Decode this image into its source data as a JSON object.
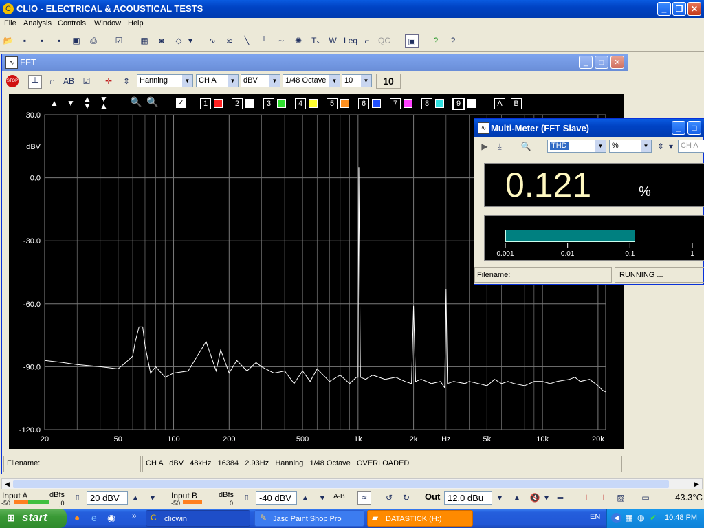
{
  "app": {
    "title": "CLIO - ELECTRICAL & ACOUSTICAL TESTS",
    "menu": [
      "File",
      "Analysis",
      "Controls",
      "Window",
      "Help"
    ]
  },
  "fft": {
    "title": "FFT",
    "window_select": "Hanning",
    "channel_select": "CH A",
    "unit_select": "dBV",
    "resolution_select": "1/48 Octave",
    "averages_select": "10",
    "averages_display": "10",
    "overlay_slots": [
      "1",
      "2",
      "3",
      "4",
      "5",
      "6",
      "7",
      "8",
      "9"
    ],
    "overlay_colors": [
      "#ff2020",
      "#ffffff",
      "#30e030",
      "#ffff30",
      "#ff9020",
      "#2050ff",
      "#ff40ff",
      "#30e0e0",
      "#ffffff"
    ],
    "overlay_ab": [
      "A",
      "B"
    ],
    "filename_label": "Filename:",
    "status_info": "CH A   dBV   48kHz   16384   2.93Hz   Hanning   1/48 Octave   OVERLOADED"
  },
  "chart_data": {
    "type": "line",
    "xlabel": "Hz",
    "ylabel": "dBV",
    "x_scale": "log",
    "xlim": [
      20,
      22000
    ],
    "ylim": [
      -120,
      30
    ],
    "y_ticks": [
      "30.0",
      "0.0",
      "-30.0",
      "-60.0",
      "-90.0",
      "-120.0"
    ],
    "x_ticks": [
      "20",
      "50",
      "100",
      "200",
      "500",
      "1k",
      "2k",
      "Hz",
      "5k",
      "10k",
      "20k"
    ],
    "grid": true,
    "trace_color": "#ffffff",
    "series": [
      {
        "x": [
          20,
          25,
          30,
          40,
          50,
          55,
          60,
          62,
          65,
          68,
          70,
          75,
          80,
          90,
          100,
          120,
          150,
          170,
          180,
          200,
          220,
          250,
          280,
          300,
          350,
          400,
          450,
          500,
          550,
          600,
          700,
          800,
          900,
          980,
          1000,
          1010,
          1030,
          1100,
          1200,
          1400,
          1600,
          1800,
          1950,
          2000,
          2050,
          2200,
          2500,
          2800,
          2950,
          3000,
          3050,
          3300,
          3800,
          4000,
          4500,
          5000,
          5500,
          6000,
          6500,
          7000,
          8000,
          9000,
          10000,
          11000,
          12000,
          14000,
          15000,
          16000,
          18000,
          20000,
          21000,
          22000
        ],
        "y": [
          -87,
          -88,
          -89,
          -90,
          -91,
          -88,
          -85,
          -78,
          -71,
          -71,
          -80,
          -93,
          -90,
          -95,
          -93,
          -92,
          -78,
          -92,
          -82,
          -93,
          -87,
          -92,
          -88,
          -90,
          -93,
          -92,
          -98,
          -92,
          -97,
          -91,
          -97,
          -94,
          -98,
          -95,
          -95,
          5,
          -95,
          -96,
          -94,
          -96,
          -95,
          -97,
          -98,
          -61,
          -97,
          -96,
          -98,
          -97,
          -100,
          -53,
          -98,
          -97,
          -98,
          -97,
          -98,
          -99,
          -96,
          -98,
          -97,
          -98,
          -99,
          -97,
          -97,
          -98,
          -97,
          -96,
          -95,
          -97,
          -96,
          -99,
          -101,
          -102
        ]
      }
    ]
  },
  "multimeter": {
    "title": "Multi-Meter (FFT Slave)",
    "measure_select": "THD",
    "unit_select": "%",
    "channel_select": "CH A",
    "reading": "0.121",
    "reading_unit": "%",
    "scale_labels": [
      "0.001",
      "0.01",
      "0.1",
      "1"
    ],
    "bar_value": 0.121,
    "bar_color": "#008080",
    "filename_label": "Filename:",
    "status": "RUNNING ..."
  },
  "controls": {
    "input_a_label": "Input A",
    "input_b_label": "Input B",
    "dbfs_label": "dBfs",
    "meter_min": "-50",
    "meter_max": ",0",
    "meter_max_b": "0",
    "input_a_value": "20 dBV",
    "input_b_value": "-40 dBV",
    "ab_label": "A-B",
    "out_label": "Out",
    "out_value": "12.0 dBu",
    "temperature": "43.3°C"
  },
  "taskbar": {
    "start": "start",
    "tasks": [
      "cliowin",
      "Jasc Paint Shop Pro",
      "DATASTICK (H:)"
    ],
    "lang": "EN",
    "clock": "10:48 PM"
  }
}
